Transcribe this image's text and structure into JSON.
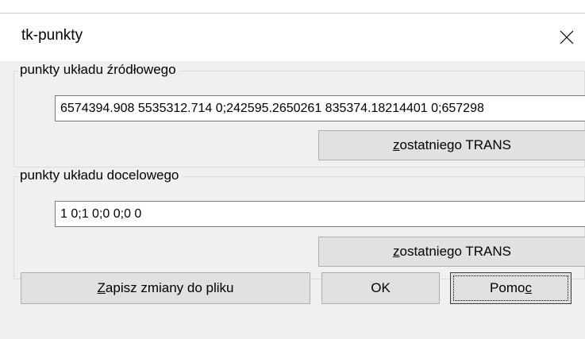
{
  "window": {
    "title": "tk-punkty",
    "close_icon": "close-icon"
  },
  "source_group": {
    "label": "punkty układu źródłowego",
    "value": "6574394.908 5535312.714 0;242595.2650261 835374.18214401 0;657298",
    "button": {
      "accel": "z",
      "rest": " ostatniego TRANS"
    }
  },
  "target_group": {
    "label": "punkty układu docelowego",
    "value": "1 0;1 0;0 0;0 0",
    "button": {
      "accel": "z",
      "rest": " ostatniego TRANS"
    }
  },
  "footer": {
    "save": {
      "accel": "Z",
      "rest": "apisz zmiany do pliku"
    },
    "ok": "OK",
    "help": {
      "before": "Pomo",
      "accel": "c"
    }
  }
}
